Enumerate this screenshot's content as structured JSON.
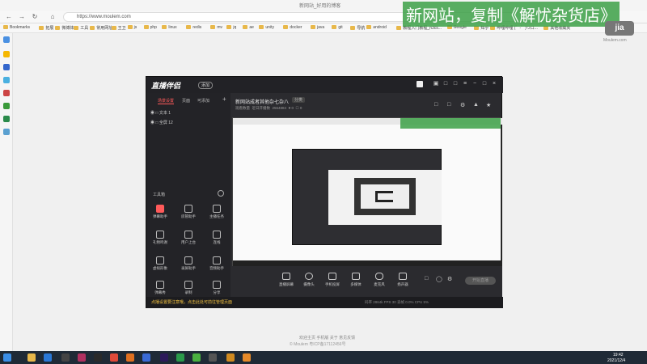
{
  "browser": {
    "tab_title": "新网站_好用的博客",
    "url": "https://www.moulem.com",
    "bookmarks": [
      "Bookmarks",
      "拓展",
      "微博体",
      "工具",
      "常用网址",
      "王卫",
      "js",
      "php",
      "linux",
      "redis",
      "mv",
      "jq",
      "ae",
      "unity",
      "docker",
      "java",
      "git",
      "导航",
      "android",
      "教程入门教程_n3cs...",
      "Google",
      "知乎",
      "哔哩哔哩 (゜-゜)つロ...",
      "其他收藏夹"
    ]
  },
  "overlay": {
    "slogan": "新网站，复制《解忧杂货店》",
    "logo_text": "jia",
    "logo_caption": "Moulem.com"
  },
  "app": {
    "logo": "直播伴侣",
    "badge": "添加",
    "sidebar": {
      "tabs": [
        "场景设置",
        "页面",
        "可添加"
      ],
      "sources": [
        "文本 1",
        "全屏 12"
      ],
      "tools_label": "工具箱",
      "tools": [
        "弹幕助手",
        "房管助手",
        "主播任务",
        "礼物鸣谢",
        "用户上台",
        "连线",
        "虚拟形象",
        "录屏助手",
        "音频助手",
        "弹幕秀",
        "录制",
        "分享"
      ]
    },
    "main": {
      "title": "新网站成者其他杂七杂八",
      "tag": "分类",
      "stats": [
        "观看数量",
        "近日开播数",
        "2564884",
        "0",
        "0"
      ]
    },
    "bottom_buttons": [
      "直播屏幕",
      "摄像头",
      "手机投屏",
      "多媒体",
      "麦克风",
      "扬声器"
    ],
    "live_button": "开始直播",
    "status_warning": "点播设置要注意哦，点击此处可前往管理页面",
    "status_right": "码率 2864k   FPS 30   丢帧 0.0%   CPU 5%"
  },
  "footer": {
    "links": "欢迎主页  手机版  关于  意见反馈",
    "icp": "© Moulem  粤ICP备17112456号"
  },
  "taskbar": {
    "time": "19:42",
    "date": "2021/12/4"
  }
}
